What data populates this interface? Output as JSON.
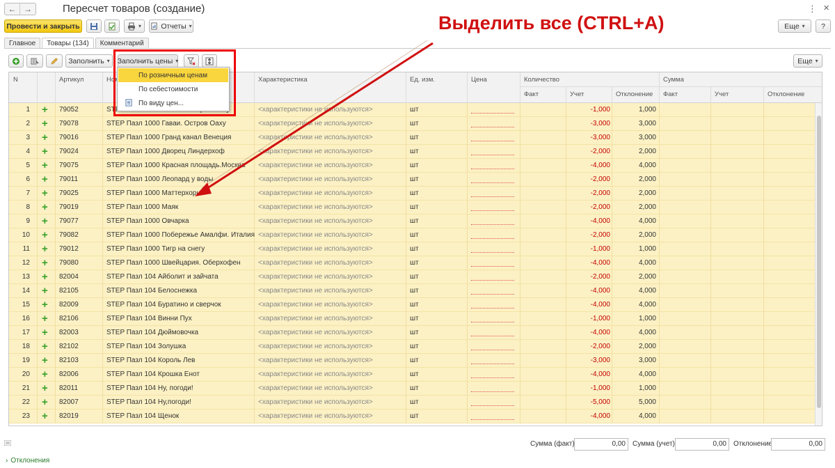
{
  "window": {
    "title": "Пересчет товаров (создание)",
    "back_icon": "←",
    "forward_icon": "→",
    "menu_icon": "⋮",
    "close_icon": "×"
  },
  "toolbar": {
    "post_close_label": "Провести и закрыть",
    "reports_label": "Отчеты",
    "more_label": "Еще",
    "help_label": "?"
  },
  "tabs": [
    {
      "label": "Главное"
    },
    {
      "label": "Товары (134)"
    },
    {
      "label": "Комментарий"
    }
  ],
  "goods_toolbar": {
    "fill_label": "Заполнить",
    "fill_prices_label": "Заполнить цены",
    "more_label": "Еще"
  },
  "dropdown": {
    "items": [
      {
        "label": "По розничным ценам"
      },
      {
        "label": "По себестоимости"
      },
      {
        "label": "По виду цен..."
      }
    ]
  },
  "columns": {
    "n": "N",
    "article": "Артикул",
    "name": "Номенклатура",
    "characteristic": "Характеристика",
    "unit": "Ед. изм.",
    "price": "Цена",
    "quantity": "Количество",
    "sum": "Сумма",
    "fact": "Факт",
    "account": "Учет",
    "deviation": "Отклонение"
  },
  "rows": [
    {
      "n": "1",
      "article": "79052",
      "name": "STEP Пазл 1000 Гавайи. Остров Оаху",
      "characteristic": "<характеристики не используются>",
      "unit": "шт",
      "q_account": "-1,000",
      "q_dev": "1,000"
    },
    {
      "n": "2",
      "article": "79078",
      "name": "STEP Пазл 1000 Гаваи. Остров Оаху",
      "characteristic": "<характеристики не используются>",
      "unit": "шт",
      "q_account": "-3,000",
      "q_dev": "3,000"
    },
    {
      "n": "3",
      "article": "79016",
      "name": "STEP Пазл 1000 Гранд канал Венеция",
      "characteristic": "<характеристики не используются>",
      "unit": "шт",
      "q_account": "-3,000",
      "q_dev": "3,000"
    },
    {
      "n": "4",
      "article": "79024",
      "name": "STEP Пазл 1000 Дворец Линдерхоф",
      "characteristic": "<характеристики не используются>",
      "unit": "шт",
      "q_account": "-2,000",
      "q_dev": "2,000"
    },
    {
      "n": "5",
      "article": "79075",
      "name": "STEP Пазл 1000 Красная площадь.Москва",
      "characteristic": "<характеристики не используются>",
      "unit": "шт",
      "q_account": "-4,000",
      "q_dev": "4,000"
    },
    {
      "n": "6",
      "article": "79011",
      "name": "STEP Пазл 1000 Леопард у воды",
      "characteristic": "<характеристики не используются>",
      "unit": "шт",
      "q_account": "-2,000",
      "q_dev": "2,000"
    },
    {
      "n": "7",
      "article": "79025",
      "name": "STEP Пазл 1000 Маттерхорн",
      "characteristic": "<характеристики не используются>",
      "unit": "шт",
      "q_account": "-2,000",
      "q_dev": "2,000"
    },
    {
      "n": "8",
      "article": "79019",
      "name": "STEP Пазл 1000 Маяк",
      "characteristic": "<характеристики не используются>",
      "unit": "шт",
      "q_account": "-2,000",
      "q_dev": "2,000"
    },
    {
      "n": "9",
      "article": "79077",
      "name": "STEP Пазл 1000 Овчарка",
      "characteristic": "<характеристики не используются>",
      "unit": "шт",
      "q_account": "-4,000",
      "q_dev": "4,000"
    },
    {
      "n": "10",
      "article": "79082",
      "name": "STEP Пазл 1000 Побережье Амалфи. Италия",
      "characteristic": "<характеристики не используются>",
      "unit": "шт",
      "q_account": "-2,000",
      "q_dev": "2,000"
    },
    {
      "n": "11",
      "article": "79012",
      "name": "STEP Пазл 1000 Тигр на снегу",
      "characteristic": "<характеристики не используются>",
      "unit": "шт",
      "q_account": "-1,000",
      "q_dev": "1,000"
    },
    {
      "n": "12",
      "article": "79080",
      "name": "STEP Пазл 1000 Швейцария. Оберхофен",
      "characteristic": "<характеристики не используются>",
      "unit": "шт",
      "q_account": "-4,000",
      "q_dev": "4,000"
    },
    {
      "n": "13",
      "article": "82004",
      "name": "STEP Пазл 104 Айболит и зайчата",
      "characteristic": "<характеристики не используются>",
      "unit": "шт",
      "q_account": "-2,000",
      "q_dev": "2,000"
    },
    {
      "n": "14",
      "article": "82105",
      "name": "STEP Пазл 104 Белоснежка",
      "characteristic": "<характеристики не используются>",
      "unit": "шт",
      "q_account": "-4,000",
      "q_dev": "4,000"
    },
    {
      "n": "15",
      "article": "82009",
      "name": "STEP Пазл 104 Буратино и сверчок",
      "characteristic": "<характеристики не используются>",
      "unit": "шт",
      "q_account": "-4,000",
      "q_dev": "4,000"
    },
    {
      "n": "16",
      "article": "82106",
      "name": "STEP Пазл 104 Винни Пух",
      "characteristic": "<характеристики не используются>",
      "unit": "шт",
      "q_account": "-1,000",
      "q_dev": "1,000"
    },
    {
      "n": "17",
      "article": "82003",
      "name": "STEP Пазл 104 Дюймовочка",
      "characteristic": "<характеристики не используются>",
      "unit": "шт",
      "q_account": "-4,000",
      "q_dev": "4,000"
    },
    {
      "n": "18",
      "article": "82102",
      "name": "STEP Пазл 104 Золушка",
      "characteristic": "<характеристики не используются>",
      "unit": "шт",
      "q_account": "-2,000",
      "q_dev": "2,000"
    },
    {
      "n": "19",
      "article": "82103",
      "name": "STEP Пазл 104 Король Лев",
      "characteristic": "<характеристики не используются>",
      "unit": "шт",
      "q_account": "-3,000",
      "q_dev": "3,000"
    },
    {
      "n": "20",
      "article": "82006",
      "name": "STEP Пазл 104 Крошка Енот",
      "characteristic": "<характеристики не используются>",
      "unit": "шт",
      "q_account": "-4,000",
      "q_dev": "4,000"
    },
    {
      "n": "21",
      "article": "82011",
      "name": "STEP Пазл 104 Ну, погоди!",
      "characteristic": "<характеристики не используются>",
      "unit": "шт",
      "q_account": "-1,000",
      "q_dev": "1,000"
    },
    {
      "n": "22",
      "article": "82007",
      "name": "STEP Пазл 104 Ну,погоди!",
      "characteristic": "<характеристики не используются>",
      "unit": "шт",
      "q_account": "-5,000",
      "q_dev": "5,000"
    },
    {
      "n": "23",
      "article": "82019",
      "name": "STEP Пазл 104 Щенок",
      "characteristic": "<характеристики не используются>",
      "unit": "шт",
      "q_account": "-4,000",
      "q_dev": "4,000"
    }
  ],
  "annotation": {
    "text": "Выделить все (CTRL+A)",
    "color": "#d01010"
  },
  "footer": {
    "sum_fact_label": "Сумма (факт):",
    "sum_fact_value": "0,00",
    "sum_account_label": "Сумма (учет):",
    "sum_account_value": "0,00",
    "deviation_label": "Отклонение:",
    "deviation_value": "0,00",
    "deviations_link": "Отклонения"
  },
  "colors": {
    "primary": "#f2c811",
    "row_highlight": "#fcf1c4",
    "negative": "#c40000",
    "plus": "#3aa12c"
  }
}
